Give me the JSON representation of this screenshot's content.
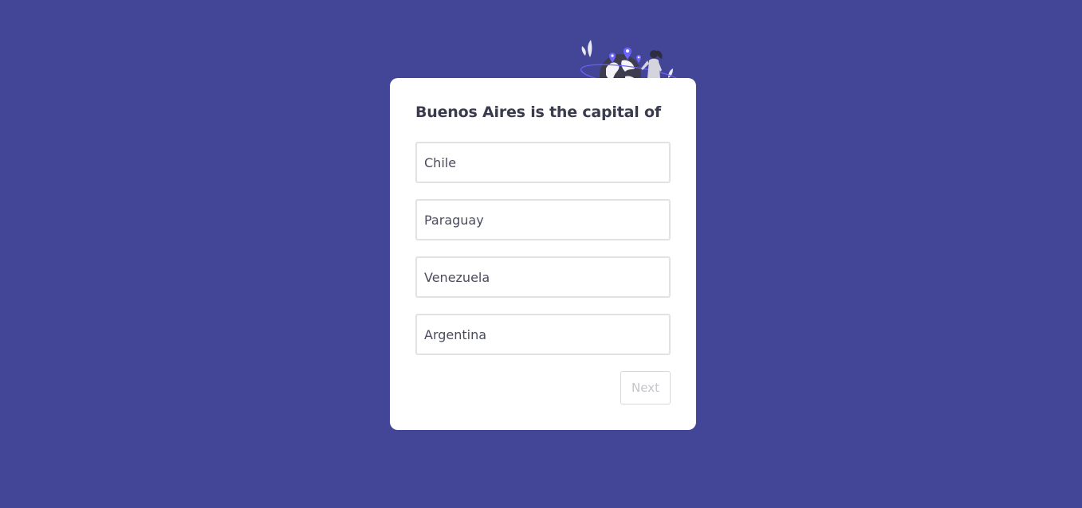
{
  "quiz": {
    "question": "Buenos Aires is the capital of",
    "options": [
      {
        "label": "Chile"
      },
      {
        "label": "Paraguay"
      },
      {
        "label": "Venezuela"
      },
      {
        "label": "Argentina"
      }
    ],
    "next_label": "Next"
  },
  "illustration": {
    "icon": "traveler-globe-illustration"
  },
  "colors": {
    "background": "#434696",
    "card": "#ffffff",
    "accent": "#6c63ff",
    "text": "#3a3b4d",
    "option_border": "#e2e2e6",
    "disabled_text": "#c4c5cb"
  }
}
